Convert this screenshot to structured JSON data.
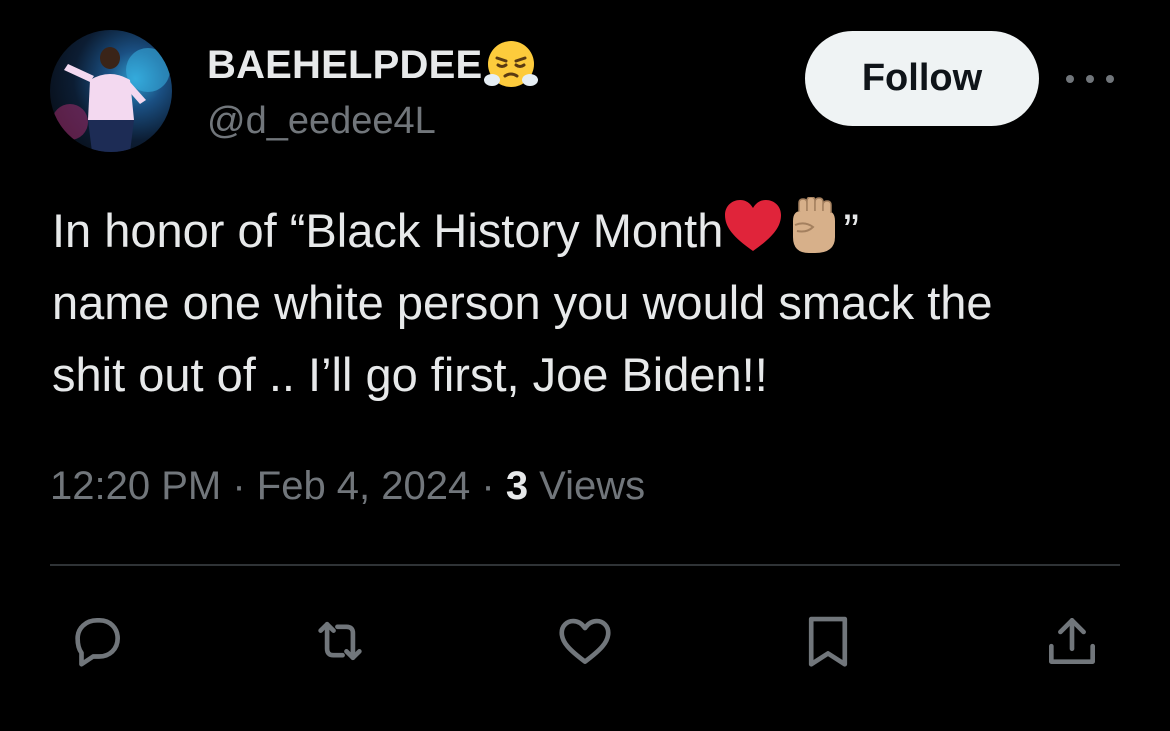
{
  "author": {
    "display_name": "BAEHELPDEE",
    "name_emoji": "face-with-steam-from-nose-emoji",
    "handle": "@d_eedee4L",
    "avatar_icon": "avatar"
  },
  "header": {
    "follow_label": "Follow",
    "more_icon": "more-dots-icon"
  },
  "tweet": {
    "line1_text": "In honor of “Black History Month",
    "line1_close": "”",
    "line1_emojis": [
      "red-heart-emoji",
      "raised-fist-emoji"
    ],
    "line2": "name one white person you would smack the",
    "line3": "shit out of .. I’ll go first, Joe Biden!!"
  },
  "meta": {
    "time": "12:20 PM",
    "separator": " · ",
    "date": "Feb 4, 2024",
    "views_count": "3",
    "views_label": " Views"
  },
  "actions": {
    "icons": [
      "reply-icon",
      "retweet-icon",
      "like-icon",
      "bookmark-icon",
      "share-icon"
    ]
  },
  "colors": {
    "background": "#000000",
    "primary_text": "#e7e9ea",
    "secondary_text": "#71767b",
    "divider": "#2f3336",
    "follow_bg": "#eff3f4",
    "follow_text": "#0f1419",
    "heart": "#e0243a"
  }
}
